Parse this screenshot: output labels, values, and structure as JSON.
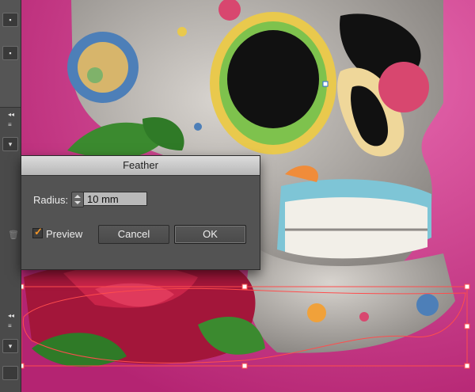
{
  "dialog": {
    "title": "Feather",
    "radius_label": "Radius:",
    "radius_value": "10 mm",
    "preview_label": "Preview",
    "preview_checked": true,
    "cancel_label": "Cancel",
    "ok_label": "OK"
  },
  "colors": {
    "background": "#c2317f",
    "dialog_bg": "#535353",
    "title_bar": "#c8c8c8",
    "check_accent": "#f09428",
    "selection_path": "#ff4d4d"
  },
  "canvas": {
    "artwork": "sugar-skull-with-roses",
    "selected_object": "roses-and-leaves-group"
  }
}
